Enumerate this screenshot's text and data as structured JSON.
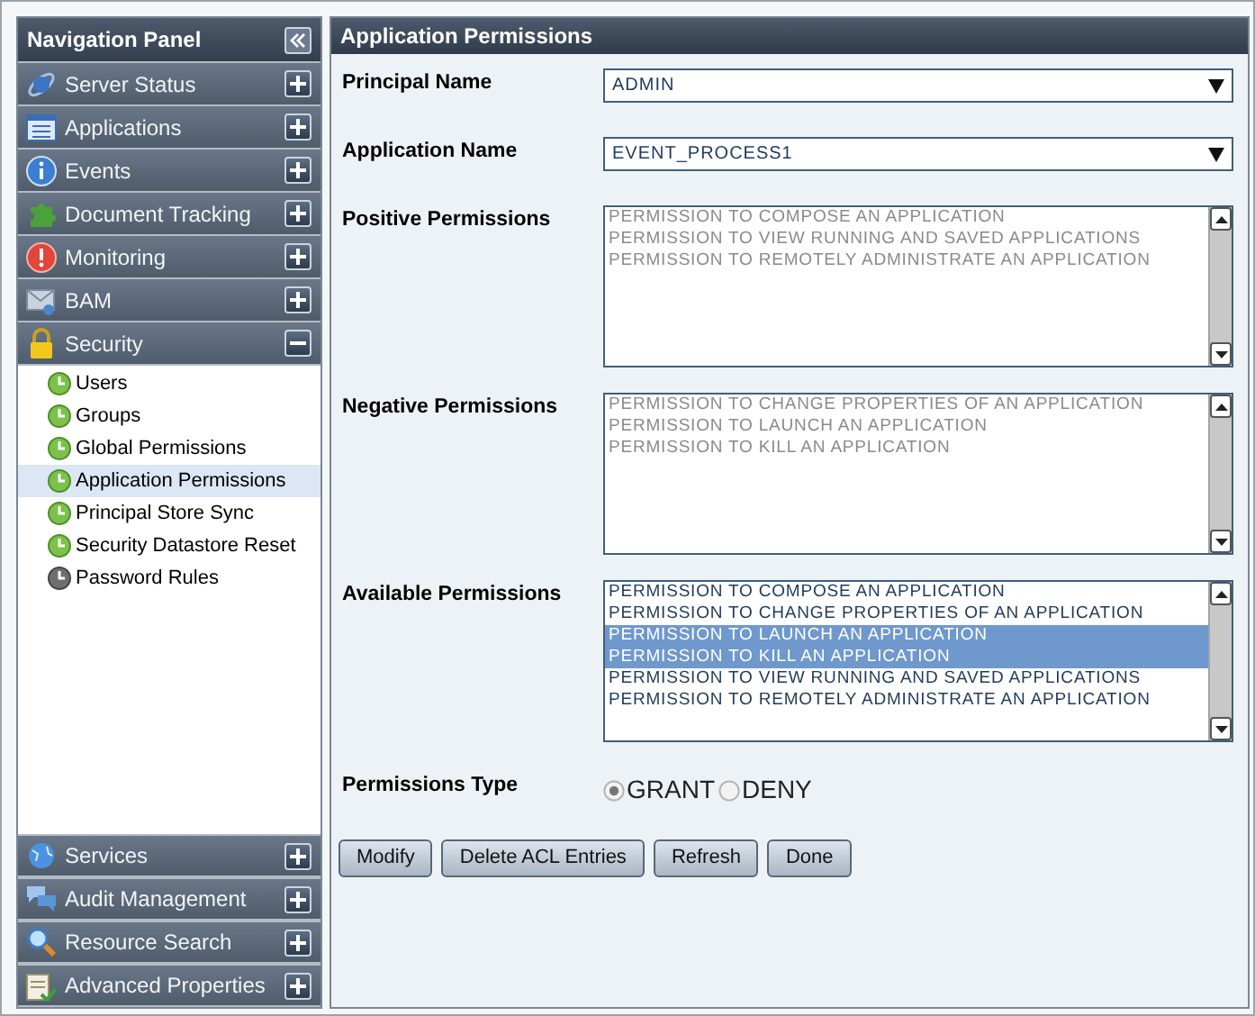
{
  "navigation_panel": {
    "title": "Navigation Panel",
    "items": [
      {
        "label": "Server Status",
        "expanded": false
      },
      {
        "label": "Applications",
        "expanded": false
      },
      {
        "label": "Events",
        "expanded": false
      },
      {
        "label": "Document Tracking",
        "expanded": false
      },
      {
        "label": "Monitoring",
        "expanded": false
      },
      {
        "label": "BAM",
        "expanded": false
      },
      {
        "label": "Security",
        "expanded": true,
        "children": [
          {
            "label": "Users",
            "selected": false
          },
          {
            "label": "Groups",
            "selected": false
          },
          {
            "label": "Global Permissions",
            "selected": false
          },
          {
            "label": "Application Permissions",
            "selected": true
          },
          {
            "label": "Principal Store Sync",
            "selected": false
          },
          {
            "label": "Security Datastore Reset",
            "selected": false
          },
          {
            "label": "Password Rules",
            "selected": false
          }
        ]
      }
    ],
    "bottom_items": [
      {
        "label": "Services",
        "expanded": false
      },
      {
        "label": "Audit Management",
        "expanded": false
      },
      {
        "label": "Resource Search",
        "expanded": false
      },
      {
        "label": "Advanced Properties",
        "expanded": false
      }
    ]
  },
  "content": {
    "title": "Application Permissions",
    "fields": [
      {
        "kind": "select",
        "label": "Principal Name",
        "value": "ADMIN"
      },
      {
        "kind": "select",
        "label": "Application Name",
        "value": "EVENT_PROCESS1"
      },
      {
        "kind": "listbox",
        "label": "Positive Permissions",
        "disabled": true,
        "items": [
          {
            "text": "PERMISSION TO COMPOSE AN APPLICATION",
            "selected": false
          },
          {
            "text": "PERMISSION TO VIEW RUNNING AND SAVED APPLICATIONS",
            "selected": false
          },
          {
            "text": "PERMISSION TO REMOTELY ADMINISTRATE AN APPLICATION",
            "selected": false
          }
        ]
      },
      {
        "kind": "listbox",
        "label": "Negative Permissions",
        "disabled": true,
        "items": [
          {
            "text": "PERMISSION TO CHANGE PROPERTIES OF AN APPLICATION",
            "selected": false
          },
          {
            "text": "PERMISSION TO LAUNCH AN APPLICATION",
            "selected": false
          },
          {
            "text": "PERMISSION TO KILL AN APPLICATION",
            "selected": false
          }
        ]
      },
      {
        "kind": "listbox",
        "label": "Available Permissions",
        "disabled": false,
        "items": [
          {
            "text": "PERMISSION TO COMPOSE AN APPLICATION",
            "selected": false
          },
          {
            "text": "PERMISSION TO CHANGE PROPERTIES OF AN APPLICATION",
            "selected": false
          },
          {
            "text": "PERMISSION TO LAUNCH AN APPLICATION",
            "selected": true
          },
          {
            "text": "PERMISSION TO KILL AN APPLICATION",
            "selected": true
          },
          {
            "text": "PERMISSION TO VIEW RUNNING AND SAVED APPLICATIONS",
            "selected": false
          },
          {
            "text": "PERMISSION TO REMOTELY ADMINISTRATE AN APPLICATION",
            "selected": false
          }
        ]
      },
      {
        "kind": "radio",
        "label": "Permissions Type",
        "options": [
          {
            "label": "GRANT",
            "selected": true
          },
          {
            "label": "DENY",
            "selected": false
          }
        ]
      }
    ],
    "buttons": [
      "Modify",
      "Delete ACL Entries",
      "Refresh",
      "Done"
    ]
  }
}
